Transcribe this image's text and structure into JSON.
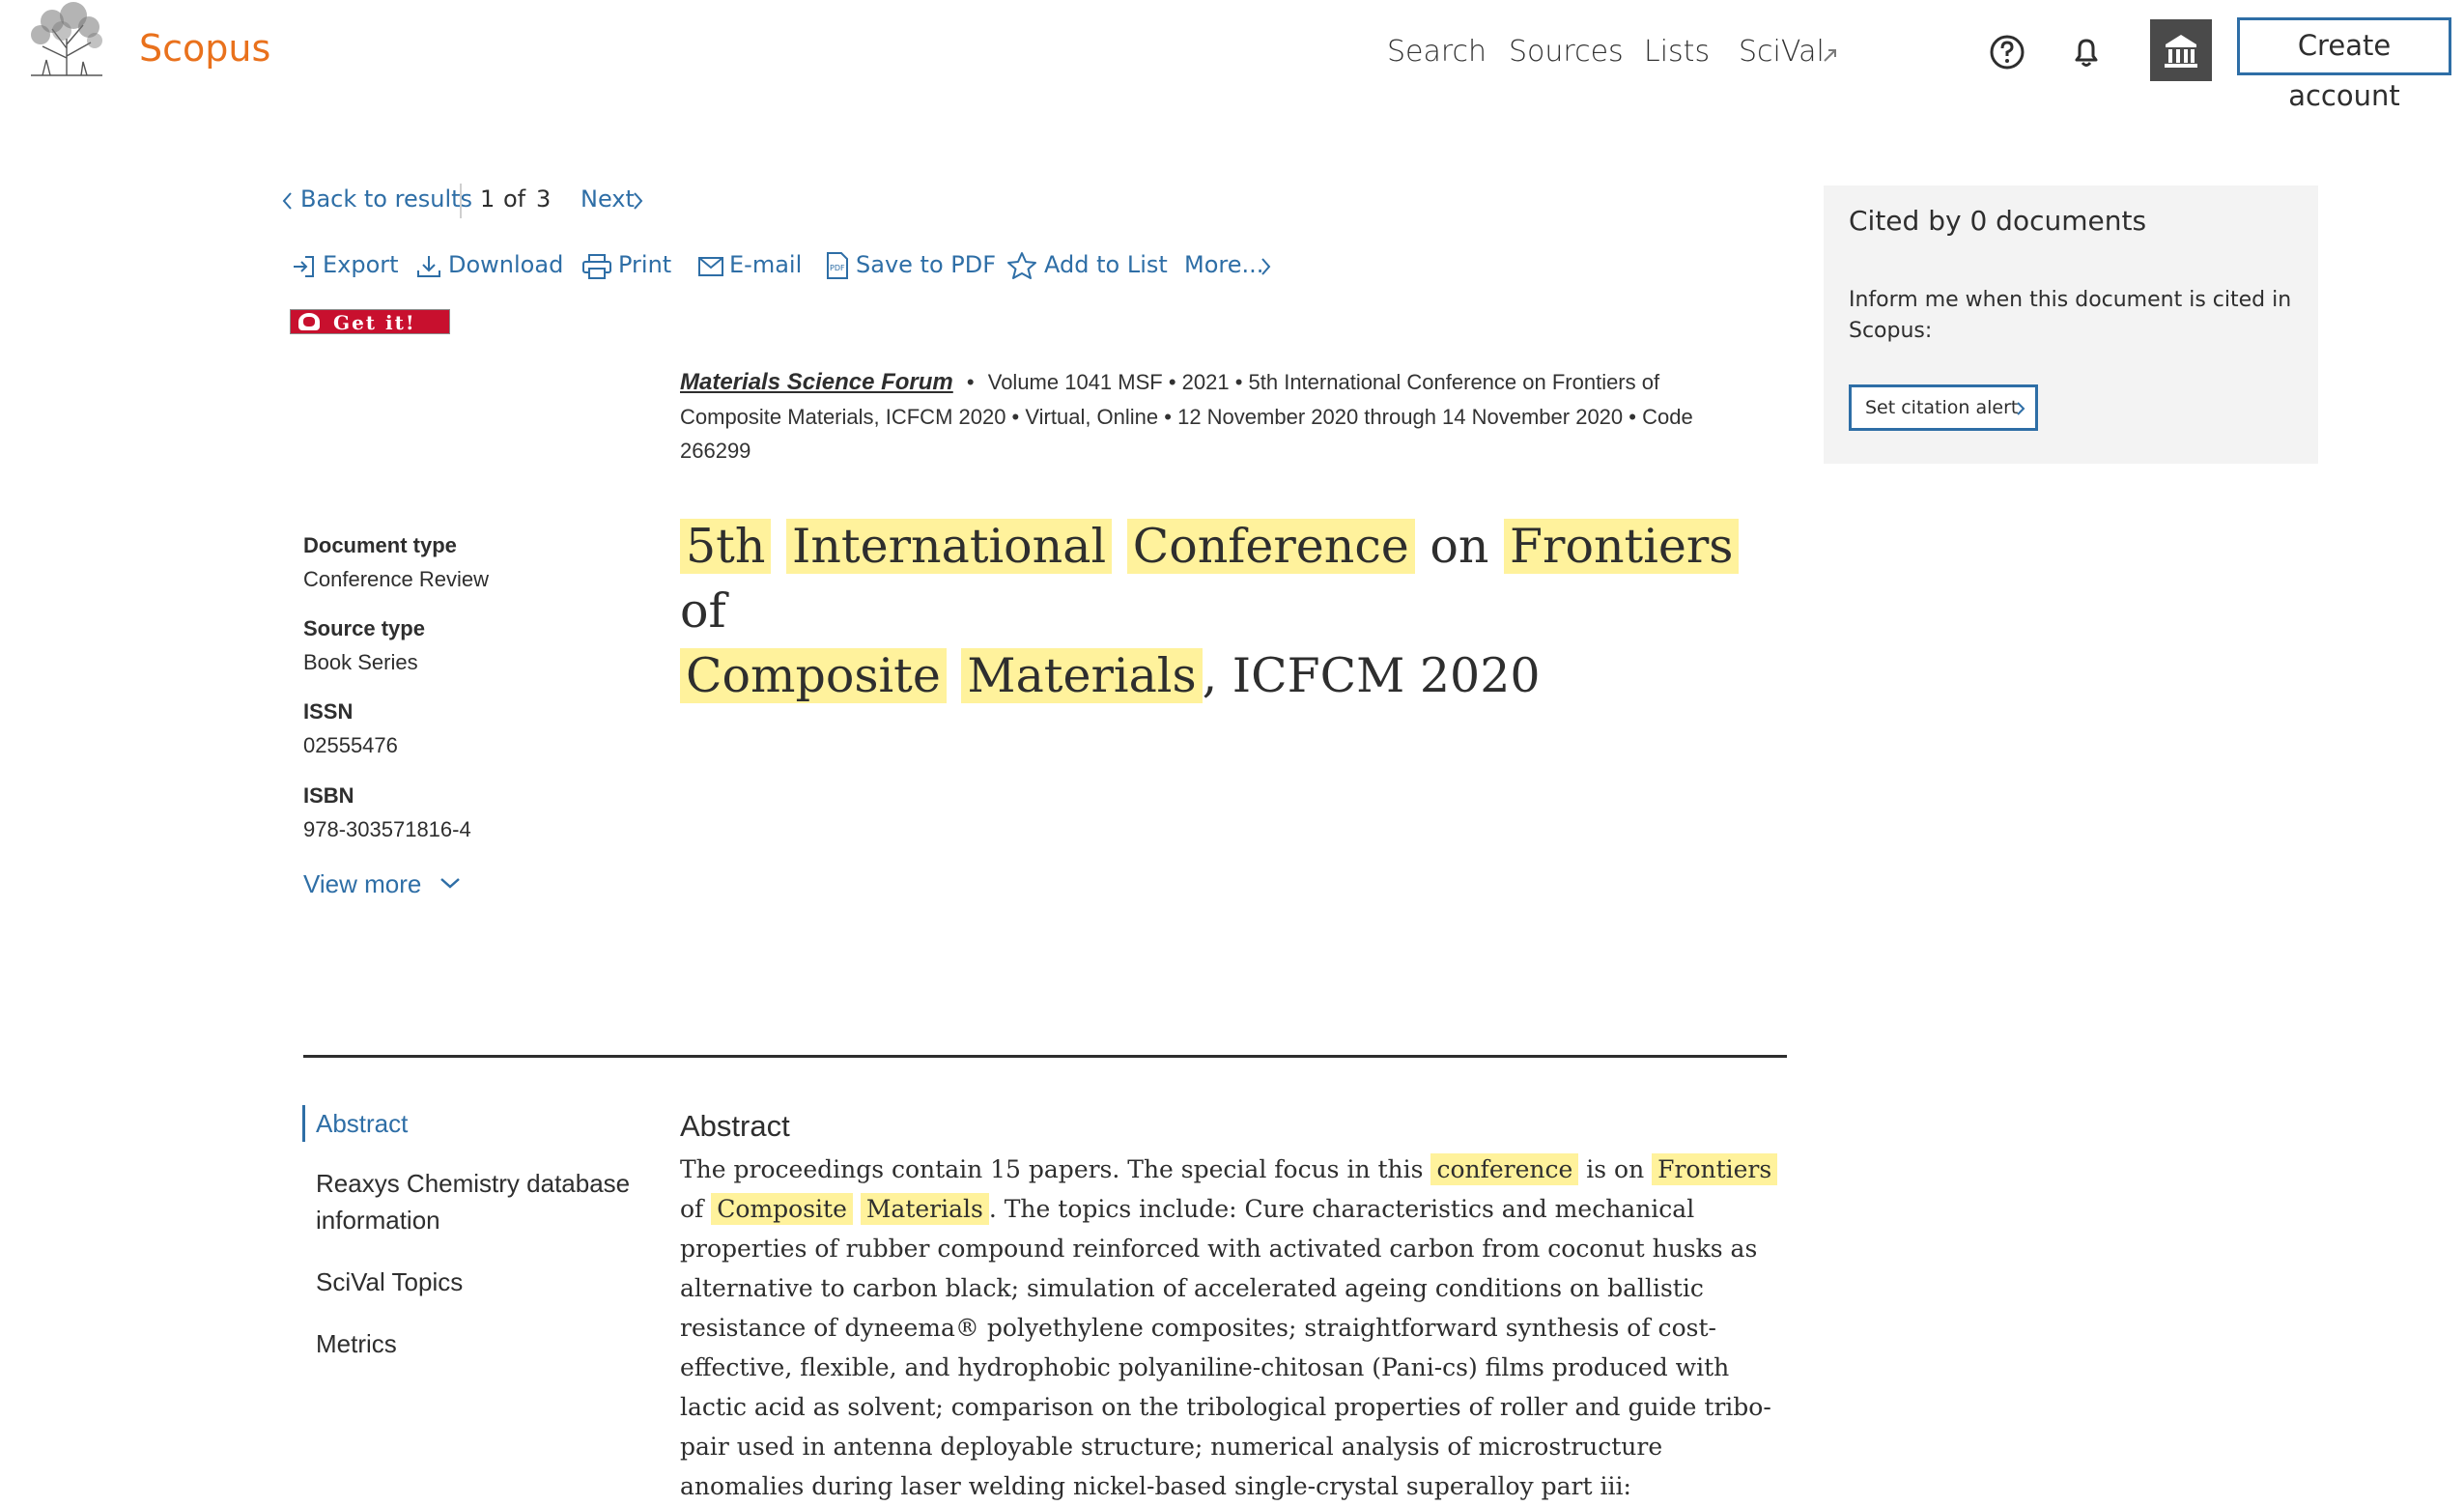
{
  "header": {
    "brand": "Scopus",
    "nav": [
      "Search",
      "Sources",
      "Lists",
      "SciVal"
    ],
    "create_account": "Create account"
  },
  "results_nav": {
    "back": "Back to results",
    "position": "1",
    "of": "of",
    "total": "3",
    "next": "Next"
  },
  "toolbar": {
    "export": "Export",
    "download": "Download",
    "print": "Print",
    "email": "E-mail",
    "save_pdf": "Save to PDF",
    "add_to_list": "Add to List",
    "more": "More..."
  },
  "getit": {
    "label": "Get it!"
  },
  "source": {
    "journal": "Materials Science Forum",
    "line1_rest": "Volume 1041 MSF  •  2021  •  5th International Conference on Frontiers of",
    "line2": "Composite Materials, ICFCM 2020  •  Virtual, Online  •  12 November 2020 through 14 November 2020  •  Code",
    "line3": "266299"
  },
  "title": {
    "w1": "5th",
    "w2": "International",
    "w3": "Conference",
    "w4": "on",
    "w5": "Frontiers",
    "w6": "of",
    "w7": "Composite",
    "w8": "Materials",
    "w9": ", ICFCM 2020"
  },
  "details": {
    "doc_type_label": "Document type",
    "doc_type": "Conference Review",
    "source_type_label": "Source type",
    "source_type": "Book Series",
    "issn_label": "ISSN",
    "issn": "02555476",
    "isbn_label": "ISBN",
    "isbn": "978-303571816-4",
    "view_more": "View more"
  },
  "cited": {
    "title": "Cited by 0 documents",
    "inform_1": "Inform me when this document is cited in",
    "inform_2": "Scopus:",
    "alert_button": "Set citation alert"
  },
  "toc": {
    "abstract": "Abstract",
    "reaxys_1": "Reaxys Chemistry database",
    "reaxys_2": "information",
    "scival": "SciVal Topics",
    "metrics": "Metrics"
  },
  "abstract": {
    "heading": "Abstract",
    "p1": "The proceedings contain 15 papers. The special focus in this",
    "h1": "conference",
    "p2": "is on",
    "h2": "Frontiers",
    "p3": "of",
    "h3": "Composite",
    "h4": "Materials",
    "p4": ". The topics include: Cure characteristics and mechanical properties of rubber compound reinforced with activated carbon from coconut husks as alternative to carbon black; simulation of accelerated ageing conditions on ballistic resistance of dyneema® polyethylene composites; straightforward synthesis of cost-effective, flexible, and hydrophobic polyaniline-chitosan (Pani-cs) films produced with lactic acid as solvent; comparison on the tribological properties of roller and guide tribo-pair used in antenna deployable structure; numerical analysis of microstructure anomalies during laser welding nickel-based single-crystal superalloy part iii:"
  }
}
